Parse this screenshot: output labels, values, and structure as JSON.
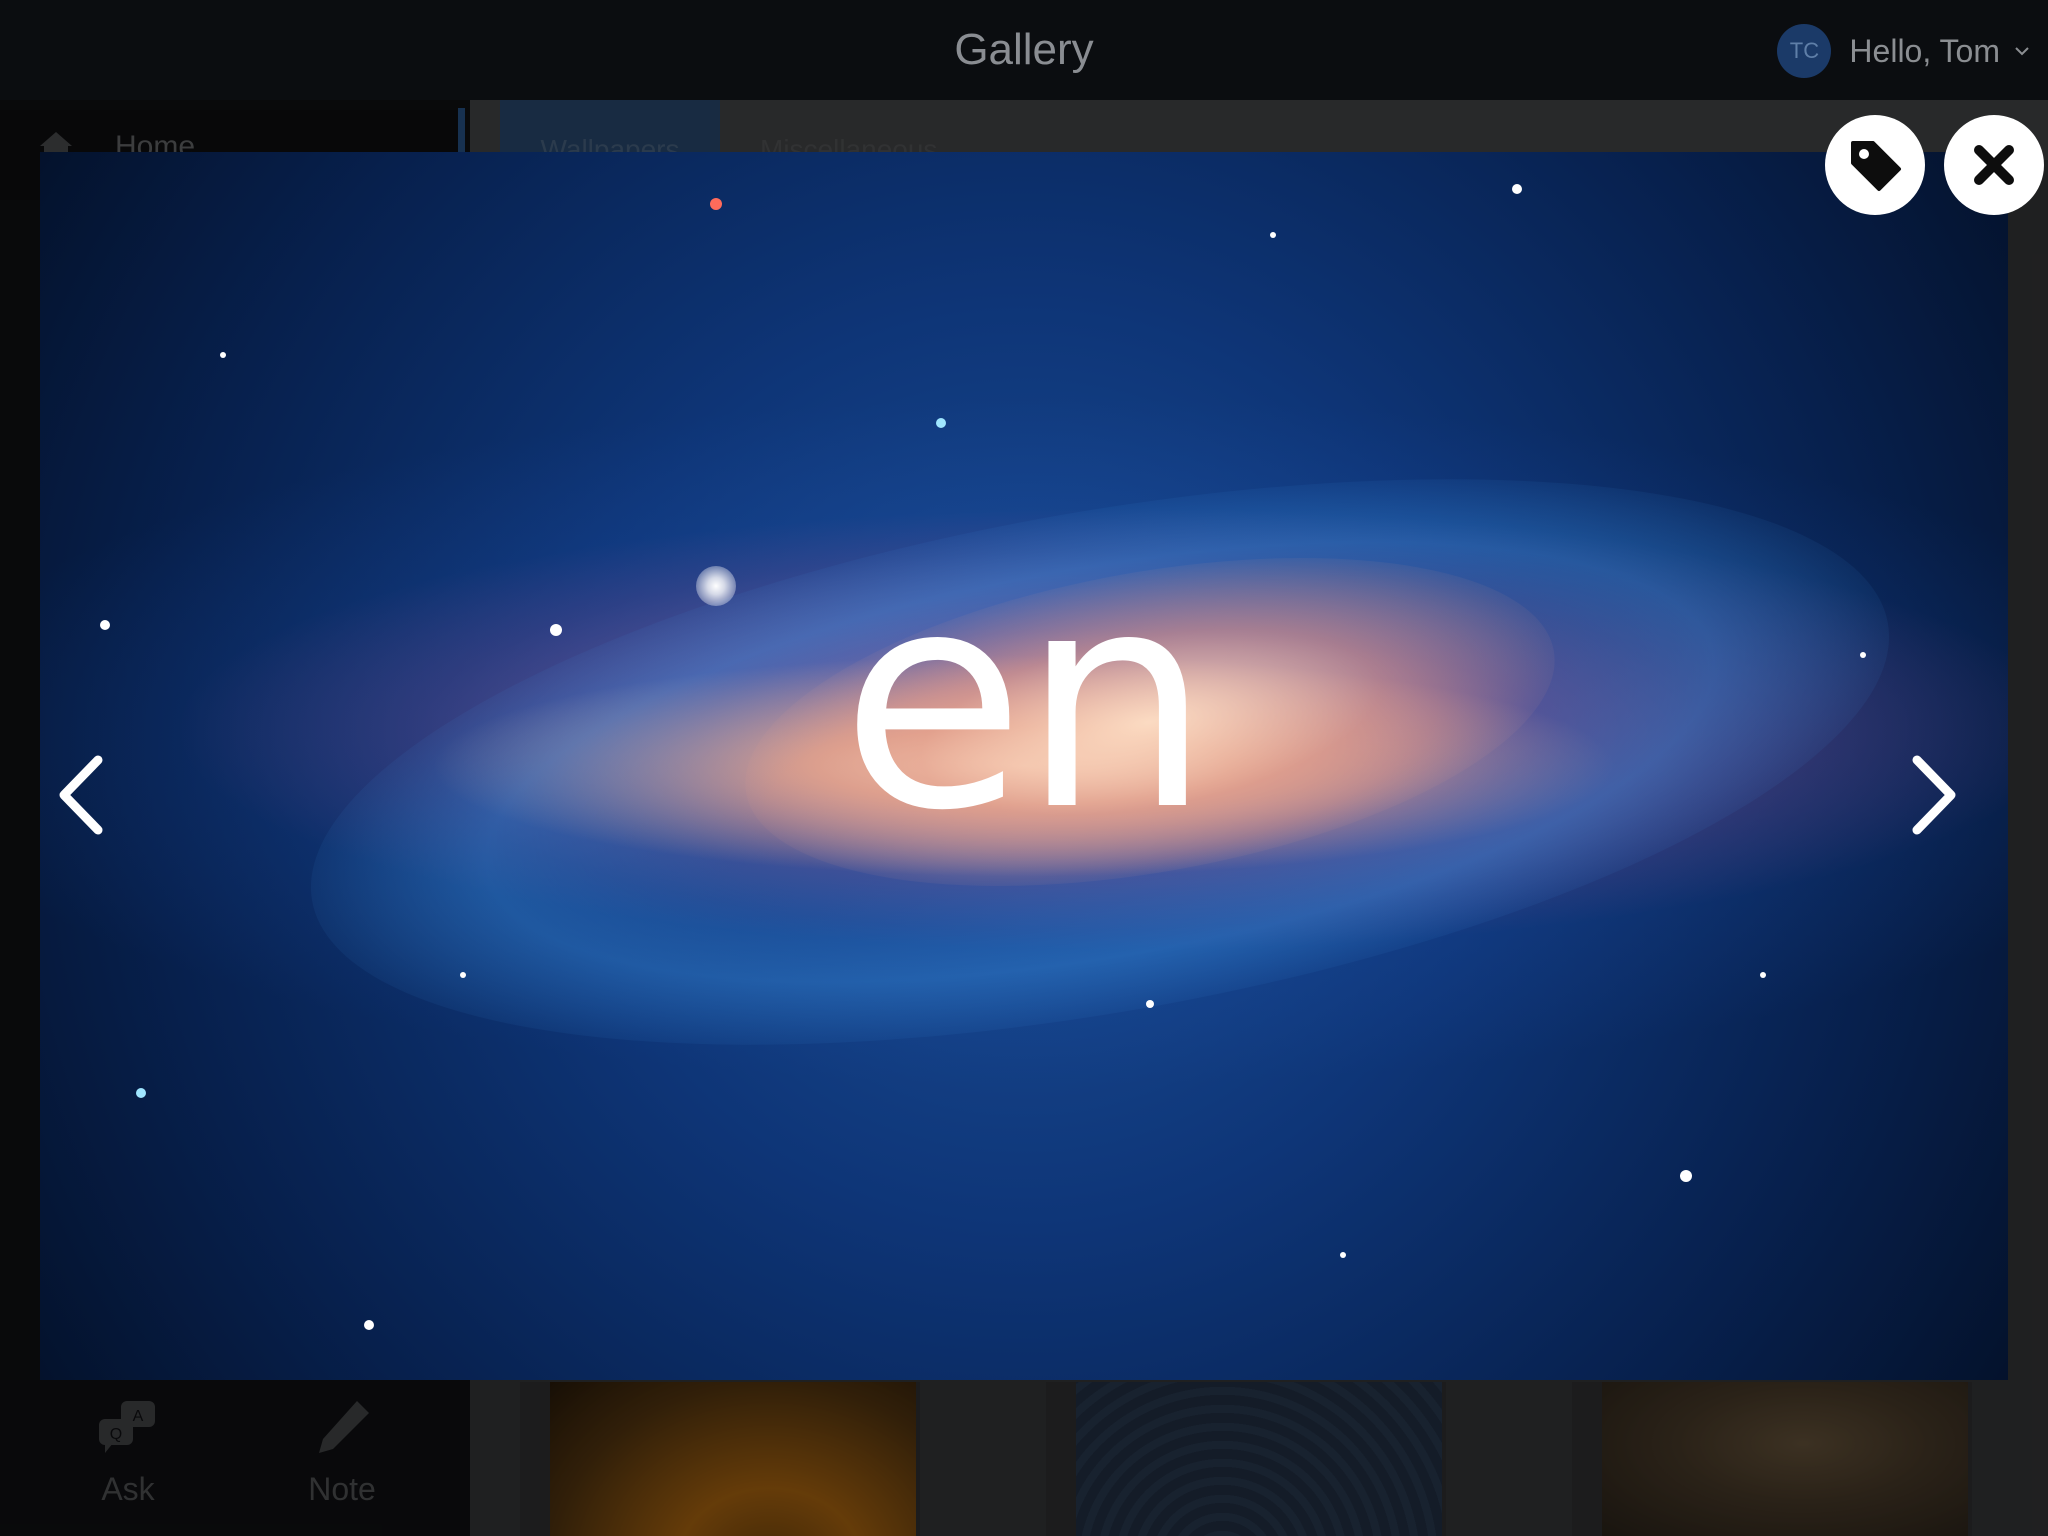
{
  "header": {
    "title": "Gallery",
    "user": {
      "initials": "TC",
      "greeting": "Hello, Tom"
    }
  },
  "sidebar": {
    "items": [
      {
        "label": "Home"
      }
    ],
    "bottom_nav": [
      {
        "label": "Ask"
      },
      {
        "label": "Note"
      }
    ]
  },
  "tabs": [
    {
      "label": "Wallpapers",
      "active": true
    },
    {
      "label": "Miscellaneous",
      "active": false
    }
  ],
  "viewer": {
    "overlay_text": "en",
    "buttons": {
      "tag": "tag-icon",
      "close": "close-icon"
    },
    "arrows": {
      "prev": "chevron-left-icon",
      "next": "chevron-right-icon"
    }
  },
  "colors": {
    "topbar": "#0b0d10",
    "avatar": "#1b3a68",
    "active_tab": "#2c4f78"
  }
}
